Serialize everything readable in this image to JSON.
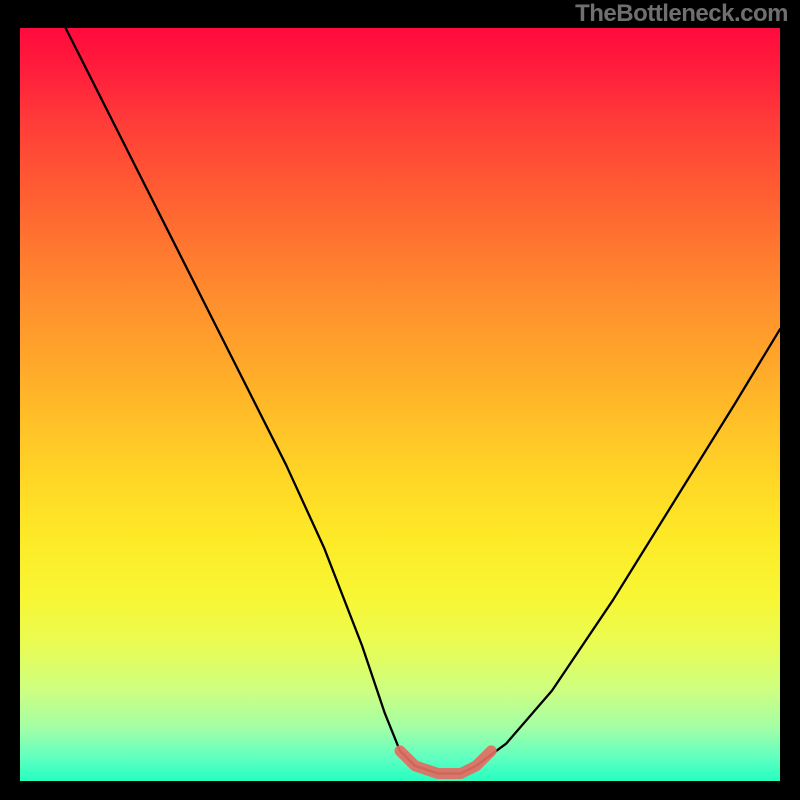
{
  "watermark": "TheBottleneck.com",
  "chart_data": {
    "type": "line",
    "title": "",
    "xlabel": "",
    "ylabel": "",
    "xlim": [
      0,
      100
    ],
    "ylim": [
      0,
      100
    ],
    "background_gradient": {
      "top": "#ff0a3d",
      "bottom": "#24ffc0",
      "stops": [
        "#ff0a3d",
        "#ff5733",
        "#ffa62a",
        "#ffd726",
        "#f7f735",
        "#cdfe81",
        "#24ffc0"
      ]
    },
    "series": [
      {
        "name": "bottleneck-curve",
        "color": "#000000",
        "x": [
          6,
          10,
          15,
          20,
          25,
          30,
          35,
          40,
          45,
          48,
          50,
          52,
          55,
          58,
          60,
          64,
          70,
          78,
          86,
          94,
          100
        ],
        "y": [
          100,
          92,
          82,
          72,
          62,
          52,
          42,
          31,
          18,
          9,
          4,
          2,
          1,
          1,
          2,
          5,
          12,
          24,
          37,
          50,
          60
        ]
      },
      {
        "name": "flat-bottom-highlight",
        "color": "#e36d62",
        "x": [
          50,
          52,
          55,
          58,
          60,
          62
        ],
        "y": [
          4,
          2,
          1,
          1,
          2,
          4
        ]
      }
    ],
    "notes": "V-shaped bottleneck profile. Red (top) = high bottleneck, green (bottom) = optimal. Black curve dips to the green band around x≈55–60. Axis ticks and numeric labels are not shown in the image; x/y values above are read proportionally from the plot area (0–100 each)."
  }
}
